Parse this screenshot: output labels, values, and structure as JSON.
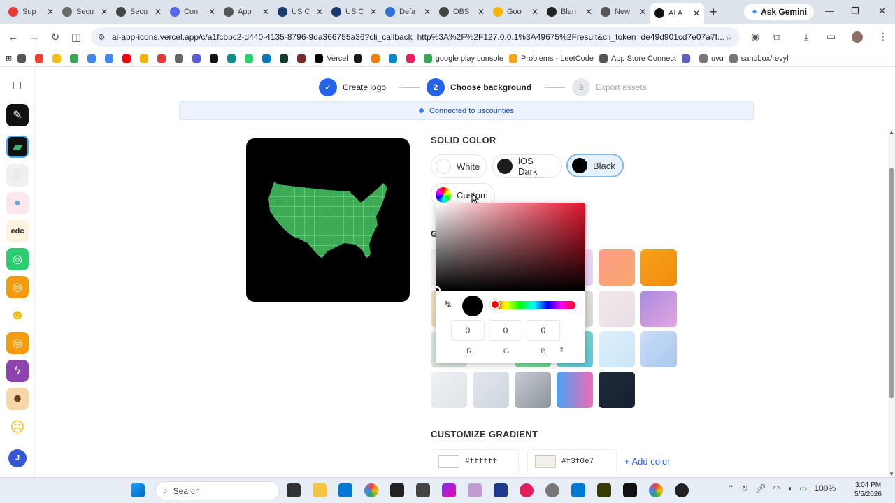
{
  "browser": {
    "tabs": [
      {
        "label": "Sup",
        "color": "#e53935"
      },
      {
        "label": "Secu",
        "color": "#6b6b6b"
      },
      {
        "label": "Secu",
        "color": "#444"
      },
      {
        "label": "Con",
        "color": "#5865f2"
      },
      {
        "label": "App",
        "color": "#555"
      },
      {
        "label": "US C",
        "color": "#1a3a6e"
      },
      {
        "label": "US C",
        "color": "#1a3a6e"
      },
      {
        "label": "Defa",
        "color": "#2f6fde"
      },
      {
        "label": "OBS",
        "color": "#444"
      },
      {
        "label": "Goo",
        "color": "#f4b400"
      },
      {
        "label": "Blan",
        "color": "#222"
      },
      {
        "label": "New",
        "color": "#555"
      },
      {
        "label": "AI A",
        "color": "#111"
      }
    ],
    "active_tab_index": 12,
    "ask_gemini": "Ask Gemini",
    "url": "ai-app-icons.vercel.app/c/a1fcbbc2-d440-4135-8796-9da366755a36?cli_callback=http%3A%2F%2F127.0.0.1%3A49675%2Fresult&cli_token=de49d901cd7e07a7f...",
    "bookmarks": [
      {
        "label": "",
        "color": "#555"
      },
      {
        "label": "",
        "color": "#ea4335"
      },
      {
        "label": "",
        "color": "#fbbc05"
      },
      {
        "label": "",
        "color": "#34a853"
      },
      {
        "label": "",
        "color": "#4285f4"
      },
      {
        "label": "",
        "color": "#4285f4"
      },
      {
        "label": "",
        "color": "#ff0000"
      },
      {
        "label": "",
        "color": "#f4b400"
      },
      {
        "label": "",
        "color": "#e53935"
      },
      {
        "label": "",
        "color": "#666"
      },
      {
        "label": "",
        "color": "#5b5bd6"
      },
      {
        "label": "",
        "color": "#111"
      },
      {
        "label": "",
        "color": "#0a8f8f"
      },
      {
        "label": "",
        "color": "#25d366"
      },
      {
        "label": "",
        "color": "#0079bf"
      },
      {
        "label": "",
        "color": "#0f3d2e"
      },
      {
        "label": "",
        "color": "#7a2a2a"
      },
      {
        "label": "Vercel",
        "color": "#000"
      },
      {
        "label": "",
        "color": "#181717"
      },
      {
        "label": "",
        "color": "#f57c00"
      },
      {
        "label": "",
        "color": "#0288d1"
      },
      {
        "label": "",
        "color": "#e91e63"
      },
      {
        "label": "google play console",
        "color": "#34a853"
      },
      {
        "label": "Problems - LeetCode",
        "color": "#ffa116"
      },
      {
        "label": "App Store Connect",
        "color": "#555"
      },
      {
        "label": "",
        "color": "#5b5fc7"
      },
      {
        "label": "uvu",
        "color": "#777"
      },
      {
        "label": "sandbox/revyl",
        "color": "#777"
      }
    ]
  },
  "stepper": {
    "steps": [
      {
        "num": "✓",
        "label": "Create logo"
      },
      {
        "num": "2",
        "label": "Choose background"
      },
      {
        "num": "3",
        "label": "Export assets"
      }
    ]
  },
  "connected": {
    "label": "Connected to uscounties"
  },
  "solid": {
    "title": "SOLID COLOR",
    "chips": [
      {
        "label": "White",
        "color": "#ffffff"
      },
      {
        "label": "iOS Dark",
        "color": "#1c1c1e"
      },
      {
        "label": "Black",
        "color": "#000000"
      },
      {
        "label": "Custom",
        "color": "conic"
      }
    ]
  },
  "gradient": {
    "title": "G"
  },
  "picker": {
    "r": "0",
    "g": "0",
    "b": "0",
    "r_label": "R",
    "g_label": "G",
    "b_label": "B",
    "toggle": "⇕"
  },
  "customize": {
    "title": "CUSTOMIZE GRADIENT",
    "color1": "#ffffff",
    "color2": "#f3f0e7",
    "add_label": "+ Add color"
  },
  "taskbar": {
    "search_label": "Search",
    "battery": "100%",
    "time": "3:04 PM",
    "date": "5/5/2026"
  }
}
